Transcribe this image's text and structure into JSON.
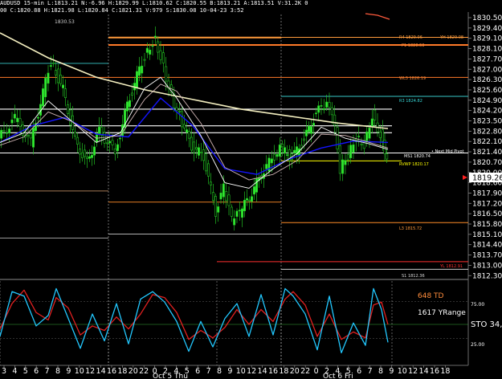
{
  "header": {
    "line1": "AUDUSD 15-min  L:1813.21  N:-6.96  H:1829.99  L:1810.62  C:1820.55  B:1813.21  A:1813.51  V:31.2K  0",
    "line2": "00  C:1820.88  H:1821.98  L:1820.84  C:1821.31  V:979  S:1830.08  10-04-23  3:52"
  },
  "price_axis": {
    "ticks": [
      "1830.50",
      "1829.40",
      "1829.10",
      "1828.10",
      "1827.70",
      "1827.00",
      "1826.30",
      "1825.60",
      "1824.90",
      "1824.20",
      "1823.50",
      "1822.80",
      "1822.10",
      "1821.40",
      "1820.70",
      "1820.00",
      "1818.60",
      "1817.90",
      "1817.20",
      "1816.50",
      "1815.80",
      "1815.10",
      "1814.40",
      "1813.70",
      "1813.00",
      "1812.30"
    ],
    "current_price": "1819.26"
  },
  "time_axis": {
    "ticks": [
      "3",
      "4",
      "5",
      "6",
      "7",
      "8",
      "9",
      "10",
      "12",
      "14",
      "16",
      "18",
      "20",
      "22",
      "0",
      "2",
      "4",
      "5",
      "6",
      "7",
      "8",
      "9",
      "10",
      "12",
      "14",
      "16",
      "18",
      "20",
      "22",
      "0",
      "2",
      "4",
      "5",
      "6",
      "7",
      "8",
      "9",
      "10",
      "12",
      "14",
      "16",
      "18"
    ],
    "date_labels": [
      "Oct 5 Thu",
      "Oct 6 Fri"
    ]
  },
  "level_labels": {
    "high_marker": "1830.53",
    "r4": "R4 1829.06",
    "yh": "YH 1829.08",
    "p1": "P1 1828.53",
    "wl3": "WL3 1826.19",
    "r3": "R3 1824.82",
    "next_mid_pivot": "Next Mid Pivot",
    "ms1": "MS1 1820.74",
    "rvwp": "RVWP 1820.17",
    "l3": "L3 1815.72",
    "yl": "YL 1812.91",
    "s1": "S1 1812.36"
  },
  "indicator": {
    "td": "648 TD",
    "yrange": "1617 YRange",
    "sto": "STO  34,",
    "level_75": "75.00",
    "level_25": "25.00"
  },
  "chart_data": {
    "type": "candlestick",
    "title": "",
    "subplots": [
      {
        "name": "price",
        "ylim": [
          1811.8,
          1830.9
        ],
        "series": [
          {
            "name": "close",
            "color": "#2bd62b",
            "x": [
              0,
              20,
              40,
              55,
              65,
              80,
              95,
              110,
              125,
              145,
              160,
              175,
              185,
              195,
              205,
              215,
              225,
              240,
              255,
              270,
              280,
              290,
              300,
              315,
              330,
              350,
              365,
              380,
              395,
              405,
              415,
              425,
              435,
              445,
              455,
              465,
              475,
              483
            ],
            "y": [
              1821.8,
              1823.2,
              1821.5,
              1825.1,
              1827.4,
              1825.3,
              1821.6,
              1820.0,
              1822.3,
              1820.8,
              1824.2,
              1826.8,
              1828.2,
              1829.0,
              1827.0,
              1824.8,
              1823.4,
              1821.2,
              1820.5,
              1816.5,
              1818.2,
              1815.9,
              1816.4,
              1817.9,
              1819.5,
              1821.1,
              1820.4,
              1821.7,
              1823.6,
              1824.2,
              1823.8,
              1819.6,
              1820.6,
              1821.9,
              1821.4,
              1823.5,
              1822.1,
              1820.5
            ]
          },
          {
            "name": "sma-long",
            "color": "#f4efc0",
            "x": [
              0,
              60,
              120,
              180,
              240,
              300,
              360,
              420,
              483
            ],
            "y": [
              1829.4,
              1827.6,
              1826.2,
              1825.3,
              1824.6,
              1823.9,
              1823.4,
              1822.9,
              1822.5
            ]
          },
          {
            "name": "ema-mid",
            "color": "#1414ff",
            "x": [
              0,
              40,
              80,
              120,
              160,
              200,
              240,
              280,
              320,
              360,
              400,
              440,
              483
            ],
            "y": [
              1821.5,
              1822.7,
              1823.3,
              1822.1,
              1821.9,
              1824.7,
              1822.7,
              1819.6,
              1819.2,
              1820.3,
              1821.1,
              1821.6,
              1821.5
            ]
          },
          {
            "name": "ema-fast-a",
            "color": "#ffffff",
            "x": [
              0,
              30,
              60,
              90,
              120,
              150,
              180,
              200,
              220,
              250,
              280,
              310,
              340,
              370,
              400,
              430,
              460,
              483
            ],
            "y": [
              1821.5,
              1822.2,
              1824.5,
              1823.0,
              1821.5,
              1822.2,
              1825.4,
              1826.2,
              1824.7,
              1822.0,
              1818.6,
              1818.2,
              1819.6,
              1820.7,
              1822.6,
              1821.8,
              1821.4,
              1821.0
            ]
          },
          {
            "name": "ema-fast-b",
            "color": "#d4b8b8",
            "x": [
              0,
              30,
              60,
              90,
              120,
              150,
              180,
              200,
              220,
              250,
              280,
              310,
              340,
              370,
              400,
              430,
              460,
              483
            ],
            "y": [
              1821.3,
              1821.9,
              1823.7,
              1823.0,
              1821.8,
              1822.0,
              1824.6,
              1825.7,
              1825.2,
              1822.9,
              1819.7,
              1818.8,
              1819.2,
              1820.2,
              1822.1,
              1822.0,
              1821.5,
              1821.1
            ]
          }
        ],
        "levels": [
          {
            "label": "R4 1829.06",
            "value": 1829.06,
            "color": "#ff9a3c"
          },
          {
            "label": "YH 1829.08",
            "value": 1829.08,
            "color": "#ff9a3c"
          },
          {
            "label": "P1 1828.53",
            "value": 1828.53,
            "color": "#ff7a28"
          },
          {
            "label": "WL3 1826.19",
            "value": 1826.19,
            "color": "#ff7a28"
          },
          {
            "label": "R3 1824.82",
            "value": 1824.82,
            "color": "#38c8c8"
          },
          {
            "label": "MS1 1820.74",
            "value": 1820.74,
            "color": "#ffffff"
          },
          {
            "label": "RVWP 1820.17",
            "value": 1820.17,
            "color": "#ffff00"
          },
          {
            "label": "L3 1815.72",
            "value": 1815.72,
            "color": "#ff8c28"
          },
          {
            "label": "YL 1812.91",
            "value": 1812.91,
            "color": "#ff3030"
          },
          {
            "label": "S1 1812.36",
            "value": 1812.36,
            "color": "#cccccc"
          }
        ]
      },
      {
        "name": "stochastic",
        "ylim": [
          0,
          100
        ],
        "series": [
          {
            "name": "%K",
            "color": "#22c8ff",
            "x": [
              0,
              15,
              30,
              45,
              60,
              70,
              85,
              100,
              115,
              130,
              145,
              160,
              175,
              190,
              205,
              220,
              235,
              250,
              265,
              280,
              295,
              310,
              325,
              340,
              355,
              365,
              380,
              395,
              410,
              425,
              440,
              455,
              465,
              475,
              483
            ],
            "y": [
              28,
              88,
              82,
              42,
              56,
              92,
              52,
              12,
              58,
              22,
              72,
              18,
              78,
              88,
              74,
              48,
              8,
              48,
              14,
              52,
              72,
              28,
              84,
              30,
              92,
              82,
              58,
              10,
              82,
              6,
              46,
              16,
              92,
              64,
              20
            ]
          },
          {
            "name": "%D",
            "color": "#e02020",
            "x": [
              0,
              15,
              30,
              45,
              60,
              70,
              85,
              100,
              115,
              130,
              145,
              160,
              175,
              190,
              205,
              220,
              235,
              250,
              265,
              280,
              295,
              310,
              325,
              340,
              355,
              365,
              380,
              395,
              410,
              425,
              440,
              455,
              465,
              475,
              483
            ],
            "y": [
              38,
              72,
              90,
              60,
              50,
              80,
              66,
              30,
              42,
              36,
              54,
              38,
              58,
              84,
              80,
              60,
              24,
              36,
              26,
              40,
              64,
              44,
              64,
              48,
              78,
              88,
              70,
              28,
              58,
              24,
              34,
              26,
              70,
              74,
              44
            ]
          }
        ]
      }
    ]
  }
}
